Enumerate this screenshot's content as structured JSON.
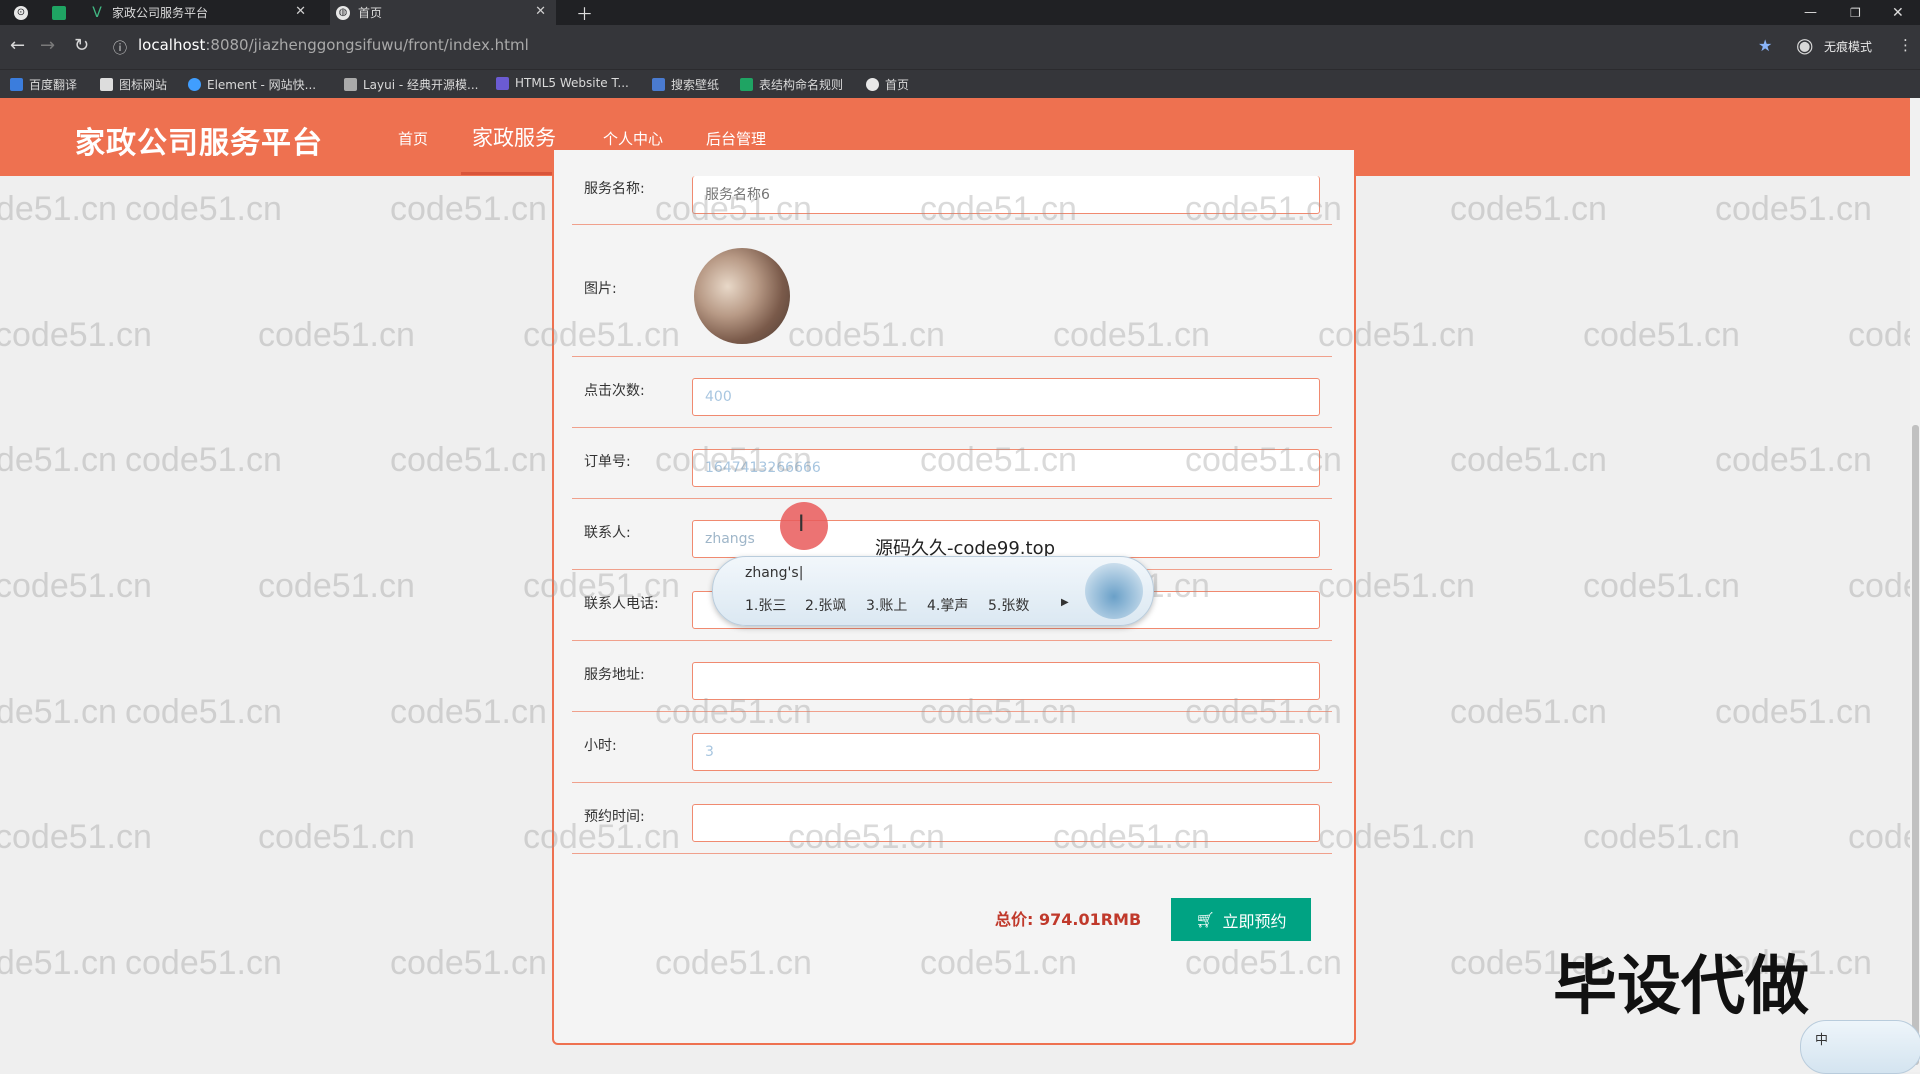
{
  "browser": {
    "tabs": [
      {
        "title": "",
        "icon": "chrome-logo-icon"
      },
      {
        "title": "",
        "icon": "green-square-icon"
      },
      {
        "title": "家政公司服务平台",
        "icon": "vue-icon"
      },
      {
        "title": "首页",
        "icon": "globe-icon"
      }
    ],
    "url_host": "localhost",
    "url_path": ":8080/jiazhenggongsifuwu/front/index.html",
    "profile_label": "无痕模式",
    "bookmarks": [
      "百度翻译",
      "图标网站",
      "Element - 网站快...",
      "Layui - 经典开源模...",
      "HTML5 Website T...",
      "搜索壁纸",
      "表结构命名规则",
      "首页"
    ]
  },
  "header": {
    "title": "家政公司服务平台",
    "menu": [
      "首页",
      "家政服务",
      "个人中心",
      "后台管理"
    ],
    "active_menu": "家政服务",
    "color": "#ee7150"
  },
  "form": {
    "fields": [
      {
        "label": "服务名称:",
        "value": "",
        "placeholder": "服务名称6"
      },
      {
        "label": "图片:",
        "value": "",
        "placeholder": ""
      },
      {
        "label": "点击次数:",
        "value": "400",
        "placeholder": ""
      },
      {
        "label": "订单号:",
        "value": "1647413266666",
        "placeholder": ""
      },
      {
        "label": "联系人:",
        "value": "zhangs",
        "placeholder": ""
      },
      {
        "label": "联系人电话:",
        "value": "",
        "placeholder": ""
      },
      {
        "label": "服务地址:",
        "value": "",
        "placeholder": ""
      },
      {
        "label": "小时:",
        "value": "3",
        "placeholder": ""
      },
      {
        "label": "预约时间:",
        "value": "",
        "placeholder": ""
      }
    ],
    "total_label": "总价:",
    "total_value": "974.01RMB",
    "book_button": "立即预约",
    "book_color": "#00a383"
  },
  "ime": {
    "composition": "zhang's|",
    "candidates": [
      "1.张三",
      "2.张飒",
      "3.账上",
      "4.掌声",
      "5.张数"
    ],
    "mini_label": "中"
  },
  "overlays": {
    "cursor_text": "源码久久-code99.top",
    "promo_text": "毕设代做",
    "watermark": "code51.cn"
  }
}
